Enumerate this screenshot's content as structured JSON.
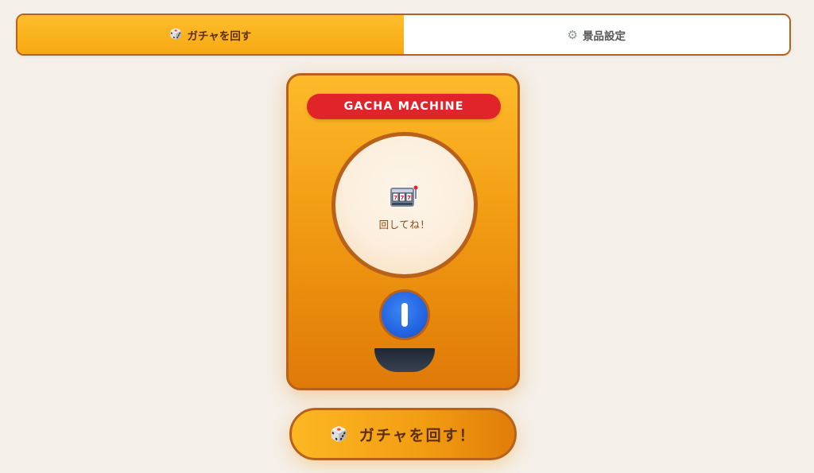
{
  "tabs": [
    {
      "icon": "dice-icon",
      "glyph": "🎲",
      "label": "ガチャを回す",
      "active": true
    },
    {
      "icon": "gear-icon",
      "glyph": "⚙",
      "label": "景品設定",
      "active": false
    }
  ],
  "machine": {
    "title": "GACHA MACHINE",
    "globe_icon": "slot-machine-icon",
    "globe_text": "回してね！"
  },
  "spin_button": {
    "icon": "dice-icon",
    "glyph": "🎲",
    "label": "ガチャを回す！"
  },
  "colors": {
    "accent": "#f6a814",
    "border": "#b8611a",
    "title_red": "#e0242a",
    "knob_blue": "#2364e0",
    "background": "#f4efe8"
  }
}
